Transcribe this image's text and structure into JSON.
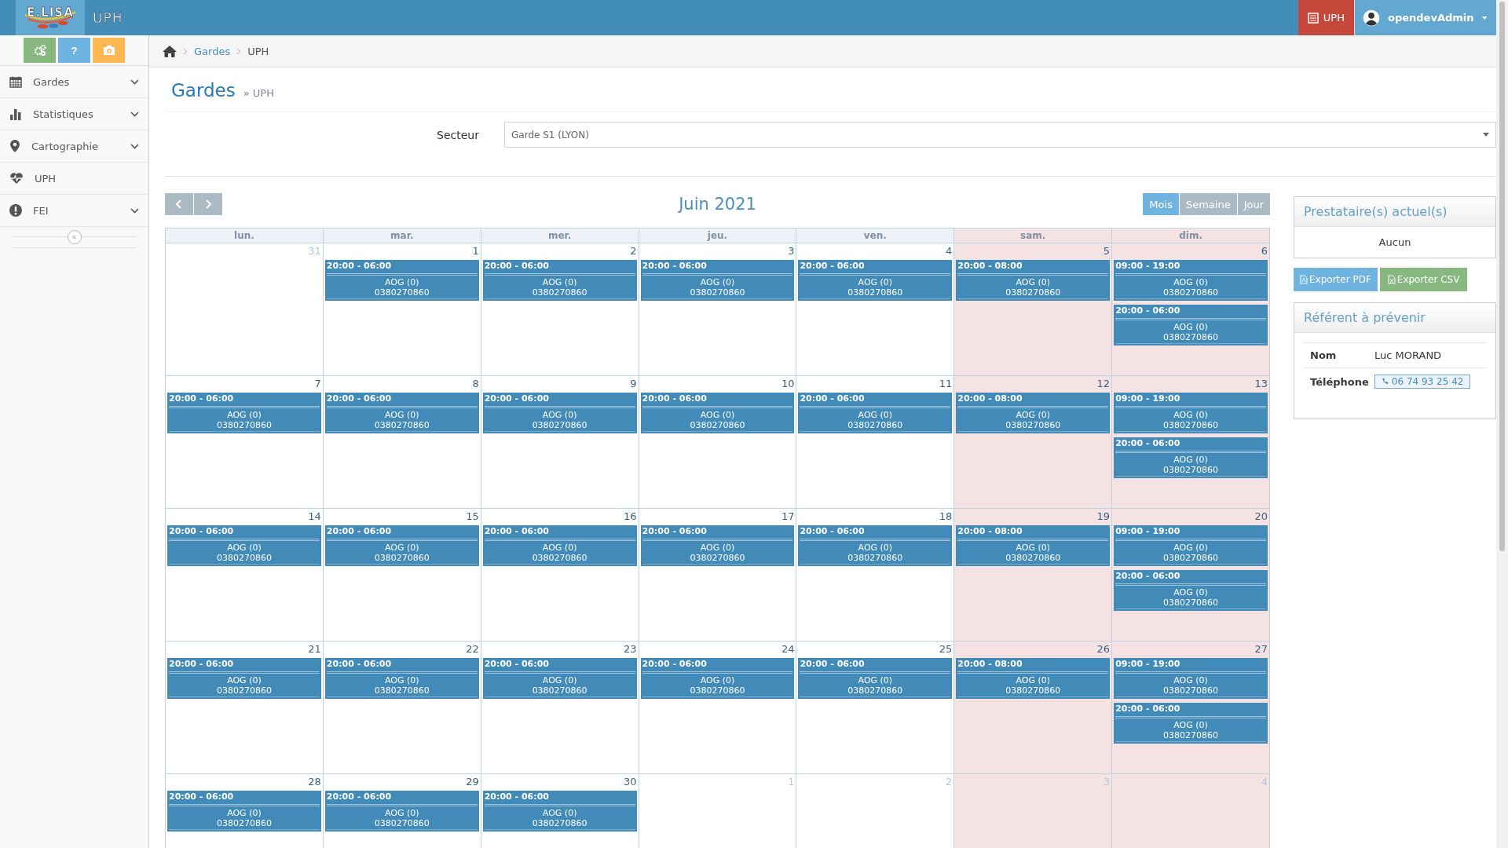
{
  "header": {
    "logo_text": "E.LISA",
    "app_title": "UPH",
    "module_button": "UPH",
    "user": "opendevAdmin"
  },
  "sidebar": {
    "quick_buttons": [
      {
        "kind": "settings",
        "color": "#87b87f"
      },
      {
        "kind": "help",
        "label": "?",
        "color": "#6fb3e0"
      },
      {
        "kind": "camera",
        "color": "#ffb752"
      }
    ],
    "items": [
      {
        "kind": "calendar",
        "label": "Gardes",
        "chevron": true
      },
      {
        "kind": "chart",
        "label": "Statistiques",
        "chevron": true
      },
      {
        "kind": "pin",
        "label": "Cartographie",
        "chevron": true
      },
      {
        "kind": "heart",
        "label": "UPH",
        "chevron": false
      },
      {
        "kind": "alert",
        "label": "FEI",
        "chevron": true
      }
    ],
    "collapse": "«"
  },
  "breadcrumb": [
    "Gardes",
    "UPH"
  ],
  "page": {
    "title": "Gardes",
    "subtitle": "» UPH"
  },
  "sector": {
    "label": "Secteur",
    "value": "Garde S1 (LYON)"
  },
  "calendar": {
    "title": "Juin 2021",
    "views": [
      {
        "label": "Mois",
        "selected": true
      },
      {
        "label": "Semaine",
        "selected": false
      },
      {
        "label": "Jour",
        "selected": false
      }
    ],
    "weekdays": [
      {
        "label": "lun.",
        "weekend": false
      },
      {
        "label": "mar.",
        "weekend": false
      },
      {
        "label": "mer.",
        "weekend": false
      },
      {
        "label": "jeu.",
        "weekend": false
      },
      {
        "label": "ven.",
        "weekend": false
      },
      {
        "label": "sam.",
        "weekend": true
      },
      {
        "label": "dim.",
        "weekend": true
      }
    ],
    "weeks": [
      [
        {
          "day": "31",
          "other_month": true
        },
        {
          "day": "1",
          "other_month": false,
          "events": [
            {
              "time": "20:00 - 06:00",
              "title": "AOG (0)",
              "phone": "0380270860"
            }
          ]
        },
        {
          "day": "2",
          "other_month": false,
          "events": [
            {
              "time": "20:00 - 06:00",
              "title": "AOG (0)",
              "phone": "0380270860"
            }
          ]
        },
        {
          "day": "3",
          "other_month": false,
          "events": [
            {
              "time": "20:00 - 06:00",
              "title": "AOG (0)",
              "phone": "0380270860"
            }
          ]
        },
        {
          "day": "4",
          "other_month": false,
          "events": [
            {
              "time": "20:00 - 06:00",
              "title": "AOG (0)",
              "phone": "0380270860"
            }
          ]
        },
        {
          "day": "5",
          "other_month": false,
          "events": [
            {
              "time": "20:00 - 08:00",
              "title": "AOG (0)",
              "phone": "0380270860"
            }
          ]
        },
        {
          "day": "6",
          "other_month": false,
          "events": [
            {
              "time": "09:00 - 19:00",
              "title": "AOG (0)",
              "phone": "0380270860"
            },
            {
              "time": "20:00 - 06:00",
              "title": "AOG (0)",
              "phone": "0380270860"
            }
          ]
        }
      ],
      [
        {
          "day": "7",
          "other_month": false,
          "events": [
            {
              "time": "20:00 - 06:00",
              "title": "AOG (0)",
              "phone": "0380270860"
            }
          ]
        },
        {
          "day": "8",
          "other_month": false,
          "events": [
            {
              "time": "20:00 - 06:00",
              "title": "AOG (0)",
              "phone": "0380270860"
            }
          ]
        },
        {
          "day": "9",
          "other_month": false,
          "events": [
            {
              "time": "20:00 - 06:00",
              "title": "AOG (0)",
              "phone": "0380270860"
            }
          ]
        },
        {
          "day": "10",
          "other_month": false,
          "events": [
            {
              "time": "20:00 - 06:00",
              "title": "AOG (0)",
              "phone": "0380270860"
            }
          ]
        },
        {
          "day": "11",
          "other_month": false,
          "events": [
            {
              "time": "20:00 - 06:00",
              "title": "AOG (0)",
              "phone": "0380270860"
            }
          ]
        },
        {
          "day": "12",
          "other_month": false,
          "events": [
            {
              "time": "20:00 - 08:00",
              "title": "AOG (0)",
              "phone": "0380270860"
            }
          ]
        },
        {
          "day": "13",
          "other_month": false,
          "events": [
            {
              "time": "09:00 - 19:00",
              "title": "AOG (0)",
              "phone": "0380270860"
            },
            {
              "time": "20:00 - 06:00",
              "title": "AOG (0)",
              "phone": "0380270860"
            }
          ]
        }
      ],
      [
        {
          "day": "14",
          "other_month": false,
          "events": [
            {
              "time": "20:00 - 06:00",
              "title": "AOG (0)",
              "phone": "0380270860"
            }
          ]
        },
        {
          "day": "15",
          "other_month": false,
          "events": [
            {
              "time": "20:00 - 06:00",
              "title": "AOG (0)",
              "phone": "0380270860"
            }
          ]
        },
        {
          "day": "16",
          "other_month": false,
          "events": [
            {
              "time": "20:00 - 06:00",
              "title": "AOG (0)",
              "phone": "0380270860"
            }
          ]
        },
        {
          "day": "17",
          "other_month": false,
          "events": [
            {
              "time": "20:00 - 06:00",
              "title": "AOG (0)",
              "phone": "0380270860"
            }
          ]
        },
        {
          "day": "18",
          "other_month": false,
          "events": [
            {
              "time": "20:00 - 06:00",
              "title": "AOG (0)",
              "phone": "0380270860"
            }
          ]
        },
        {
          "day": "19",
          "other_month": false,
          "events": [
            {
              "time": "20:00 - 08:00",
              "title": "AOG (0)",
              "phone": "0380270860"
            }
          ]
        },
        {
          "day": "20",
          "other_month": false,
          "events": [
            {
              "time": "09:00 - 19:00",
              "title": "AOG (0)",
              "phone": "0380270860"
            },
            {
              "time": "20:00 - 06:00",
              "title": "AOG (0)",
              "phone": "0380270860"
            }
          ]
        }
      ],
      [
        {
          "day": "21",
          "other_month": false,
          "events": [
            {
              "time": "20:00 - 06:00",
              "title": "AOG (0)",
              "phone": "0380270860"
            }
          ]
        },
        {
          "day": "22",
          "other_month": false,
          "events": [
            {
              "time": "20:00 - 06:00",
              "title": "AOG (0)",
              "phone": "0380270860"
            }
          ]
        },
        {
          "day": "23",
          "other_month": false,
          "events": [
            {
              "time": "20:00 - 06:00",
              "title": "AOG (0)",
              "phone": "0380270860"
            }
          ]
        },
        {
          "day": "24",
          "other_month": false,
          "events": [
            {
              "time": "20:00 - 06:00",
              "title": "AOG (0)",
              "phone": "0380270860"
            }
          ]
        },
        {
          "day": "25",
          "other_month": false,
          "events": [
            {
              "time": "20:00 - 06:00",
              "title": "AOG (0)",
              "phone": "0380270860"
            }
          ]
        },
        {
          "day": "26",
          "other_month": false,
          "events": [
            {
              "time": "20:00 - 08:00",
              "title": "AOG (0)",
              "phone": "0380270860"
            }
          ]
        },
        {
          "day": "27",
          "other_month": false,
          "events": [
            {
              "time": "09:00 - 19:00",
              "title": "AOG (0)",
              "phone": "0380270860"
            },
            {
              "time": "20:00 - 06:00",
              "title": "AOG (0)",
              "phone": "0380270860"
            }
          ]
        }
      ],
      [
        {
          "day": "28",
          "other_month": false,
          "events": [
            {
              "time": "20:00 - 06:00",
              "title": "AOG (0)",
              "phone": "0380270860"
            }
          ]
        },
        {
          "day": "29",
          "other_month": false,
          "events": [
            {
              "time": "20:00 - 06:00",
              "title": "AOG (0)",
              "phone": "0380270860"
            }
          ]
        },
        {
          "day": "30",
          "other_month": false,
          "events": [
            {
              "time": "20:00 - 06:00",
              "title": "AOG (0)",
              "phone": "0380270860"
            }
          ]
        },
        {
          "day": "1",
          "other_month": true
        },
        {
          "day": "2",
          "other_month": true
        },
        {
          "day": "3",
          "other_month": true
        },
        {
          "day": "4",
          "other_month": true
        }
      ]
    ]
  },
  "providers": {
    "title": "Prestataire(s) actuel(s)",
    "value": "Aucun"
  },
  "exports": [
    {
      "kind": "pdf",
      "label": "Exporter PDF"
    },
    {
      "kind": "csv",
      "label": "Exporter CSV"
    }
  ],
  "referent": {
    "title": "Référent à prévenir",
    "name_label": "Nom",
    "name": "Luc MORAND",
    "phone_label": "Téléphone",
    "phone": "06 74 93 25 42"
  }
}
